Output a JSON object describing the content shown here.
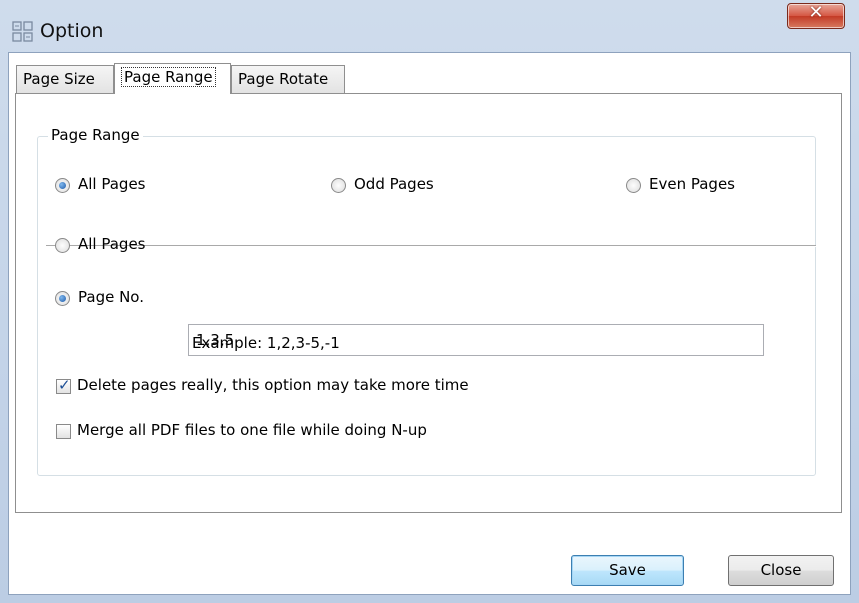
{
  "window": {
    "title": "Option",
    "close_symbol": "✕"
  },
  "tabs": [
    {
      "label": "Page Size",
      "active": false
    },
    {
      "label": "Page Range",
      "active": true
    },
    {
      "label": "Page Rotate",
      "active": false
    }
  ],
  "page_range": {
    "group_title": "Page Range",
    "scope_options": [
      {
        "label": "All Pages",
        "checked": true
      },
      {
        "label": "Odd Pages",
        "checked": false
      },
      {
        "label": "Even Pages",
        "checked": false
      }
    ],
    "range_options": [
      {
        "label": "All Pages",
        "checked": false
      },
      {
        "label": "Page No.",
        "checked": true
      }
    ],
    "page_no_value": "1,3,5",
    "example_text": "Example: 1,2,3-5,-1",
    "checkboxes": [
      {
        "label": "Delete pages really, this option may take more time",
        "checked": true
      },
      {
        "label": "Merge all PDF files to one file while doing N-up",
        "checked": false
      }
    ]
  },
  "buttons": {
    "save": "Save",
    "close": "Close"
  },
  "colors": {
    "titlebar": "#c3d3e8",
    "close_button": "#c9432c",
    "radio_dot": "#1f5aa8",
    "check_mark": "#1e4f96"
  }
}
